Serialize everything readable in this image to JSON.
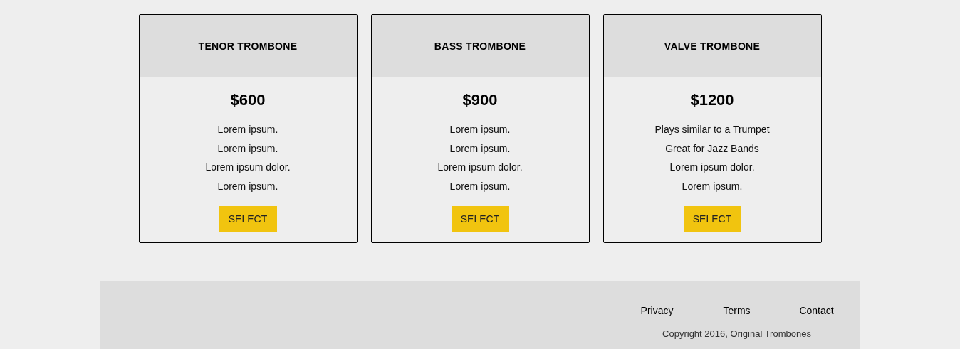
{
  "plans": [
    {
      "title": "TENOR TROMBONE",
      "price": "$600",
      "features": [
        "Lorem ipsum.",
        "Lorem ipsum.",
        "Lorem ipsum dolor.",
        "Lorem ipsum."
      ],
      "button": "SELECT"
    },
    {
      "title": "BASS TROMBONE",
      "price": "$900",
      "features": [
        "Lorem ipsum.",
        "Lorem ipsum.",
        "Lorem ipsum dolor.",
        "Lorem ipsum."
      ],
      "button": "SELECT"
    },
    {
      "title": "VALVE TROMBONE",
      "price": "$1200",
      "features": [
        "Plays similar to a Trumpet",
        "Great for Jazz Bands",
        "Lorem ipsum dolor.",
        "Lorem ipsum."
      ],
      "button": "SELECT"
    }
  ],
  "footer": {
    "links": [
      "Privacy",
      "Terms",
      "Contact"
    ],
    "copyright": "Copyright 2016, Original Trombones"
  }
}
